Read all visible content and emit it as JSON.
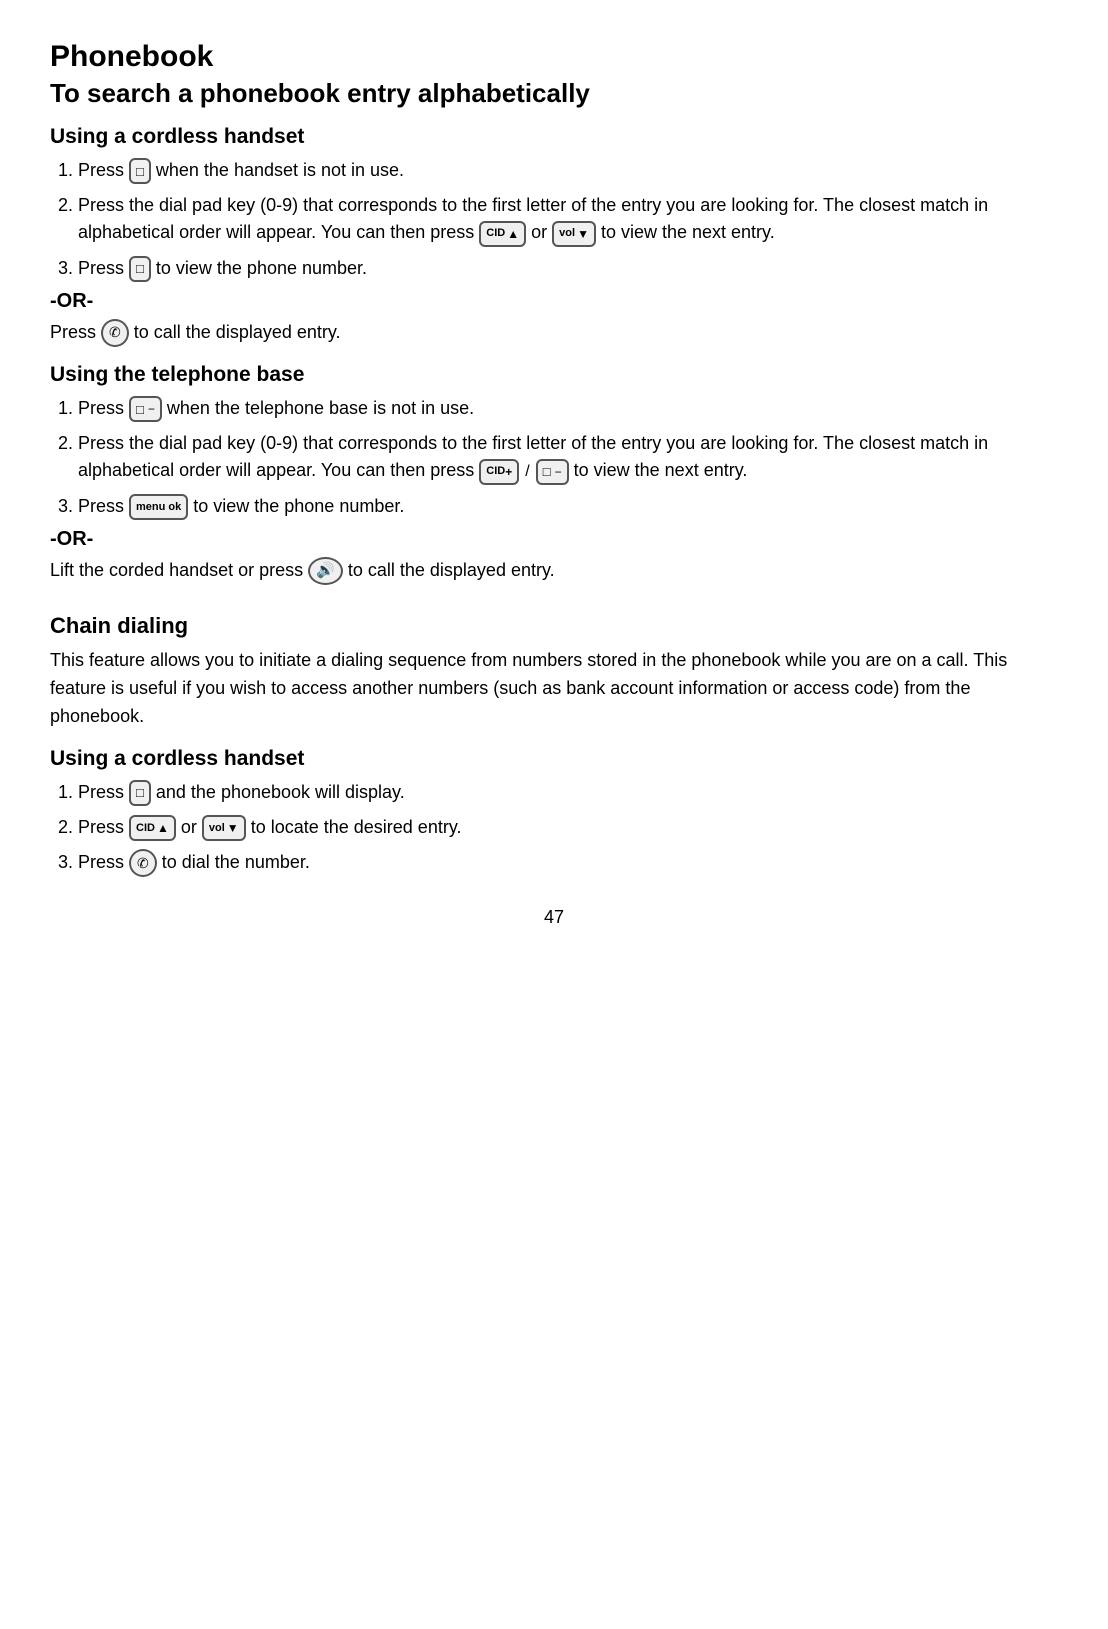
{
  "page": {
    "title": "Phonebook",
    "subtitle": "To search a phonebook entry alphabetically",
    "section1": {
      "heading": "Using a cordless handset",
      "steps": [
        "Press [phonebook] when the handset is not in use.",
        "Press the dial pad key (0-9) that corresponds to the first letter of the entry you are looking for. The closest match in alphabetical order will appear. You can then press [cid-up] or [vol-down] to view the next entry.",
        "Press [phonebook] to view the phone number."
      ],
      "or_label": "-OR-",
      "step3_or": "Press [call] to call the displayed entry."
    },
    "section2": {
      "heading": "Using the telephone base",
      "steps": [
        "Press [phonebook-base] when the telephone base is not in use.",
        "Press the dial pad key (0-9) that corresponds to the first letter of the entry you are looking for. The closest match in alphabetical order will appear. You can then press [cid-plus] / [phonebook-base] to view the next entry.",
        "Press [menu-ok] to view the phone number."
      ],
      "or_label": "-OR-",
      "step3_or": "Lift the corded handset or press [speaker] to call the displayed entry."
    },
    "section3": {
      "heading": "Chain dialing",
      "description": "This feature allows you to initiate a dialing sequence from numbers stored in the phonebook while you are on a call. This feature is useful if you wish to access another numbers (such as bank account information or access code) from the phonebook.",
      "sub_heading": "Using a cordless handset",
      "steps": [
        "Press [phonebook] and the phonebook will display.",
        "Press [cid-up] or [vol-down] to locate the desired entry.",
        "Press [call] to dial the number."
      ]
    },
    "page_number": "47"
  }
}
